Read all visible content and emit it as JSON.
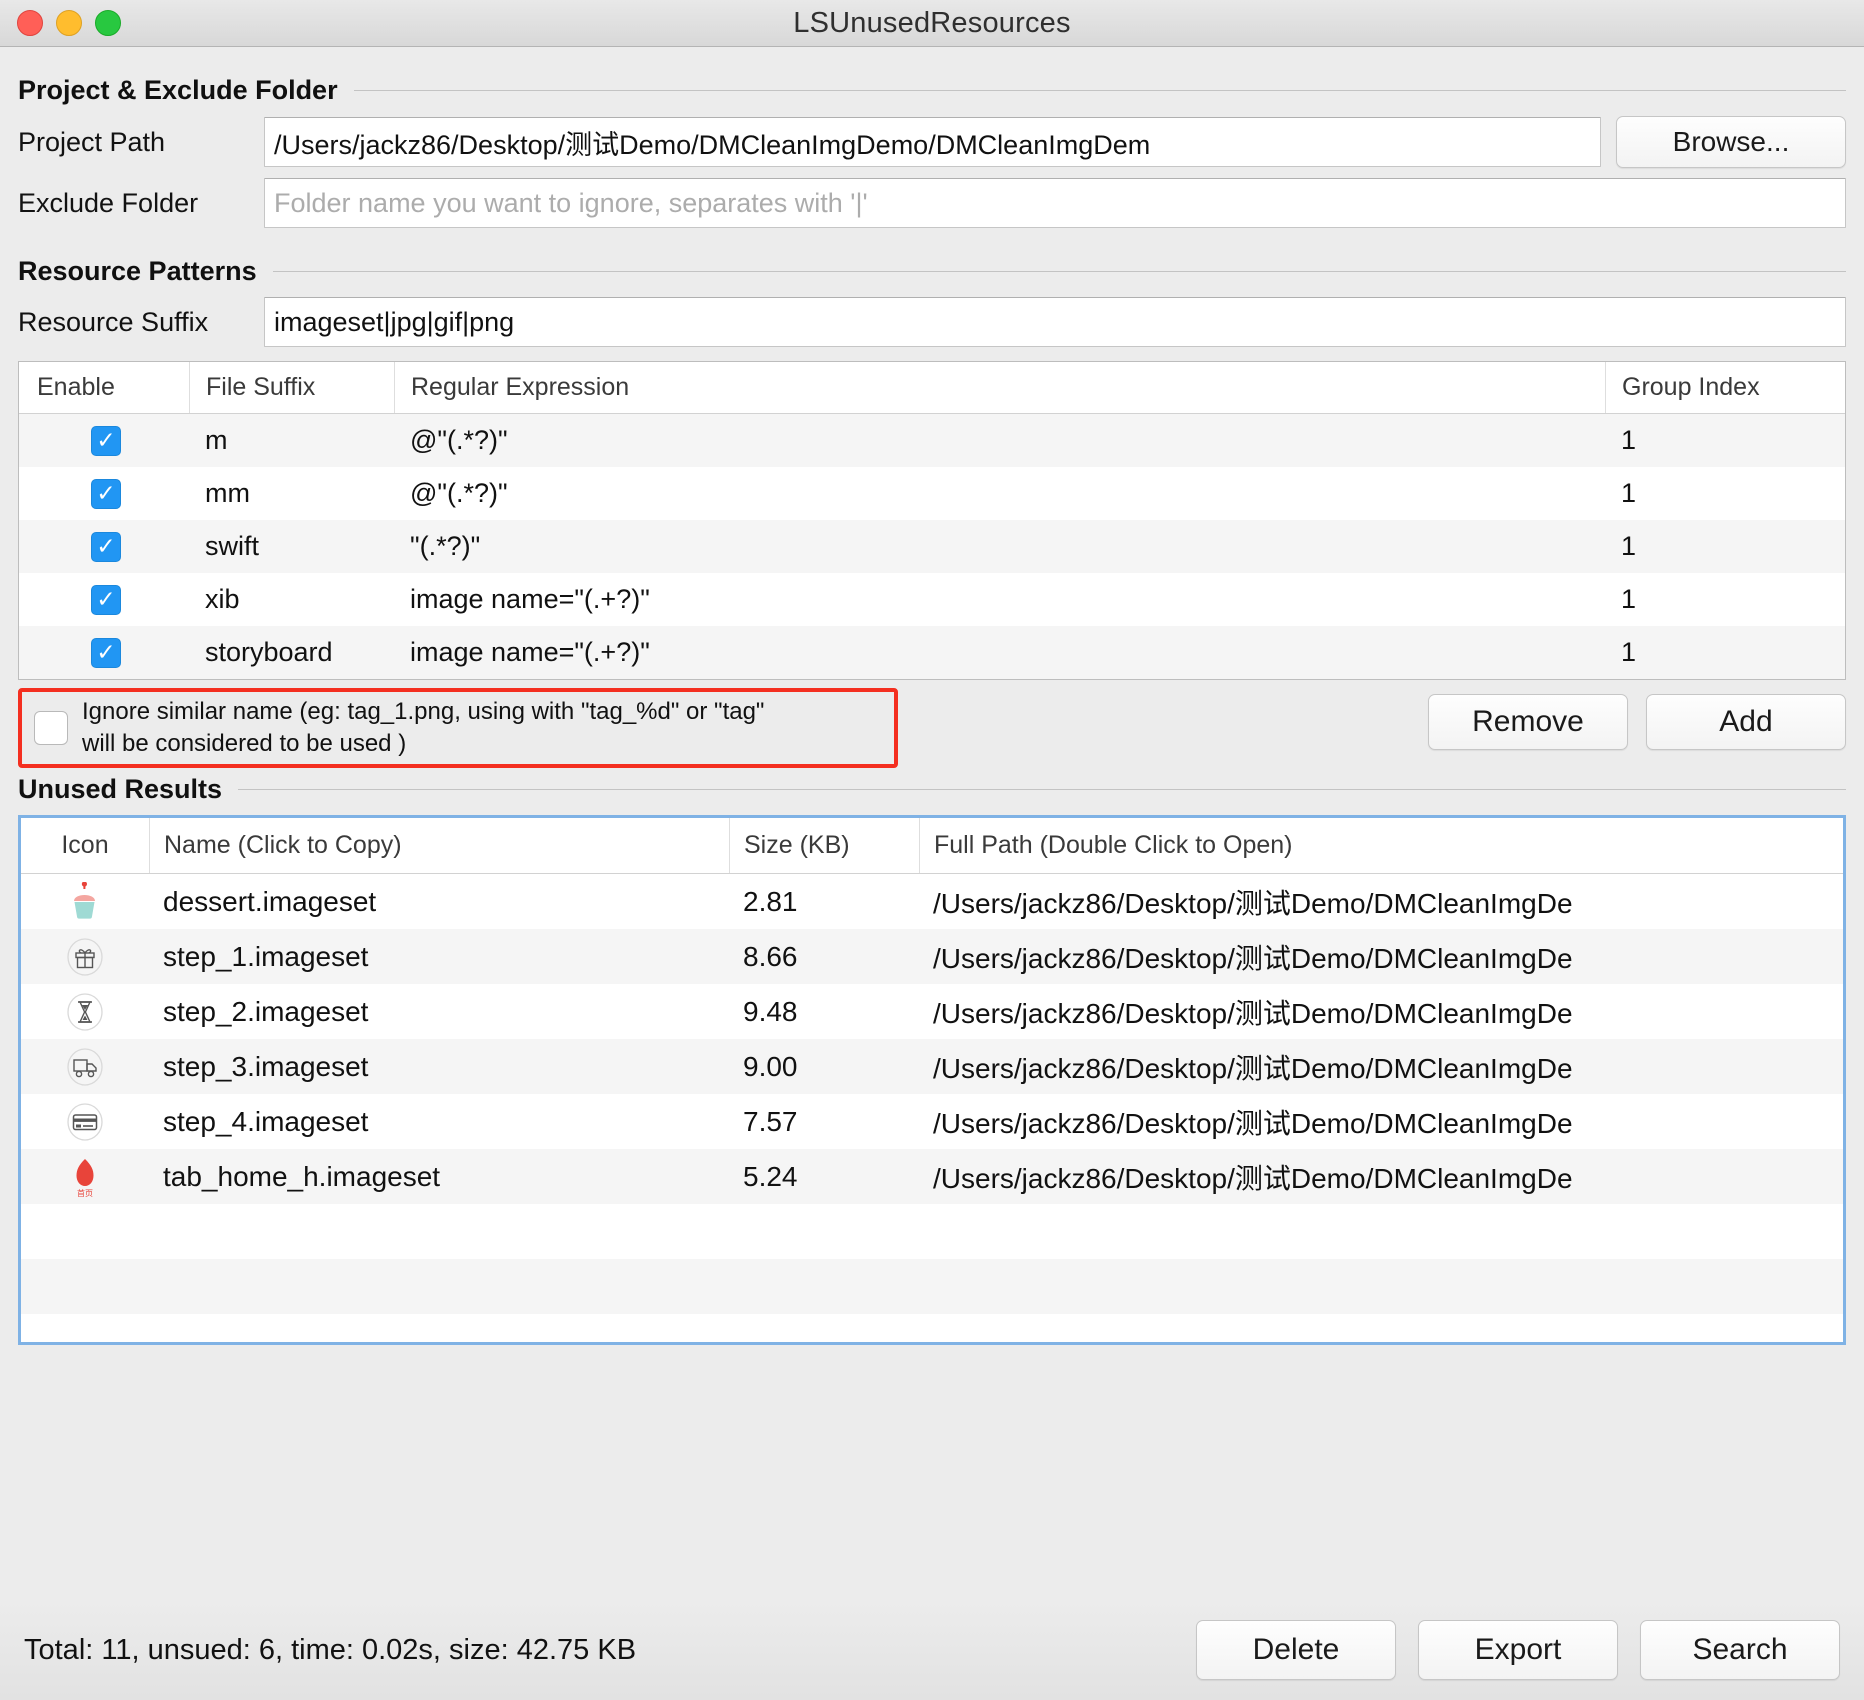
{
  "window": {
    "title": "LSUnusedResources",
    "traffic_lights": [
      "close-button",
      "minimize-button",
      "zoom-button"
    ]
  },
  "sections": {
    "project": {
      "heading": "Project & Exclude Folder",
      "project_path_label": "Project Path",
      "project_path_value": "/Users/jackz86/Desktop/测试Demo/DMCleanImgDemo/DMCleanImgDem",
      "browse_label": "Browse...",
      "exclude_label": "Exclude Folder",
      "exclude_value": "",
      "exclude_placeholder": "Folder name you want to ignore, separates with '|'"
    },
    "patterns": {
      "heading": "Resource Patterns",
      "suffix_label": "Resource Suffix",
      "suffix_value": "imageset|jpg|gif|png",
      "columns": [
        "Enable",
        "File Suffix",
        "Regular Expression",
        "Group Index"
      ],
      "rows": [
        {
          "enabled": true,
          "suffix": "m",
          "regex": "@\"(.*?)\"",
          "group": "1"
        },
        {
          "enabled": true,
          "suffix": "mm",
          "regex": "@\"(.*?)\"",
          "group": "1"
        },
        {
          "enabled": true,
          "suffix": "swift",
          "regex": "\"(.*?)\"",
          "group": "1"
        },
        {
          "enabled": true,
          "suffix": "xib",
          "regex": "image name=\"(.+?)\"",
          "group": "1"
        },
        {
          "enabled": true,
          "suffix": "storyboard",
          "regex": "image name=\"(.+?)\"",
          "group": "1"
        }
      ],
      "ignore_checked": false,
      "ignore_label_line1": "Ignore similar name (eg: tag_1.png, using with \"tag_%d\" or \"tag\"",
      "ignore_label_line2": "will be considered to be used )",
      "remove_label": "Remove",
      "add_label": "Add",
      "highlight_color": "#f42f20"
    },
    "results": {
      "heading": "Unused Results",
      "columns": [
        "Icon",
        "Name (Click to Copy)",
        "Size (KB)",
        "Full Path (Double Click to Open)"
      ],
      "focus_ring_color": "#7fb2e5",
      "rows": [
        {
          "icon": "cupcake-icon",
          "name": "dessert.imageset",
          "size": "2.81",
          "path": "/Users/jackz86/Desktop/测试Demo/DMCleanImgDe"
        },
        {
          "icon": "gift-icon",
          "name": "step_1.imageset",
          "size": "8.66",
          "path": "/Users/jackz86/Desktop/测试Demo/DMCleanImgDe"
        },
        {
          "icon": "hourglass-icon",
          "name": "step_2.imageset",
          "size": "9.48",
          "path": "/Users/jackz86/Desktop/测试Demo/DMCleanImgDe"
        },
        {
          "icon": "truck-icon",
          "name": "step_3.imageset",
          "size": "9.00",
          "path": "/Users/jackz86/Desktop/测试Demo/DMCleanImgDe"
        },
        {
          "icon": "credit-card-icon",
          "name": "step_4.imageset",
          "size": "7.57",
          "path": "/Users/jackz86/Desktop/测试Demo/DMCleanImgDe"
        },
        {
          "icon": "home-tab-icon",
          "name": "tab_home_h.imageset",
          "size": "5.24",
          "path": "/Users/jackz86/Desktop/测试Demo/DMCleanImgDe"
        }
      ]
    }
  },
  "footer": {
    "status": "Total: 11, unsued: 6, time: 0.02s, size: 42.75 KB",
    "delete_label": "Delete",
    "export_label": "Export",
    "search_label": "Search"
  }
}
